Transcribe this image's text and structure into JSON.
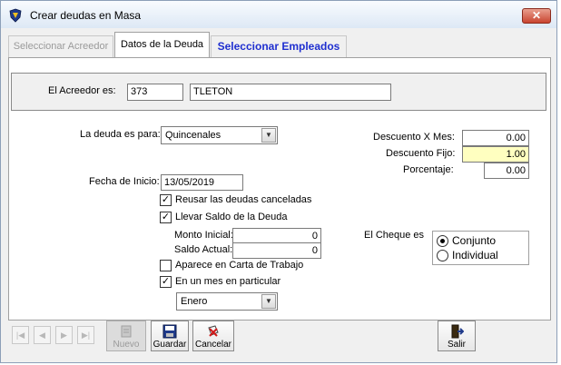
{
  "window": {
    "title": "Crear deudas en Masa",
    "close_label": "✕",
    "app_icon": "app-shield-icon"
  },
  "tabs": [
    {
      "label": "Seleccionar Acreedor",
      "state": "disabled"
    },
    {
      "label": "Datos de la Deuda",
      "state": "active"
    },
    {
      "label": "Seleccionar Empleados",
      "state": "highlighted"
    }
  ],
  "acreedor": {
    "label": "El Acreedor es:",
    "code": "373",
    "name": "TLETON"
  },
  "deuda": {
    "para_label": "La deuda es para:",
    "para_value": "Quincenales",
    "fecha_label": "Fecha de Inicio:",
    "fecha_value": "13/05/2019",
    "reusar_label": "Reusar las deudas canceladas",
    "reusar_checked": true,
    "saldo_label": "Llevar Saldo de la Deuda",
    "saldo_checked": true,
    "monto_inicial_label": "Monto Inicial:",
    "monto_inicial_value": "0",
    "saldo_actual_label": "Saldo Actual:",
    "saldo_actual_value": "0",
    "carta_label": "Aparece en Carta de Trabajo",
    "carta_checked": false,
    "mes_label": "En un mes en particular",
    "mes_checked": true,
    "mes_value": "Enero"
  },
  "descuentos": {
    "por_mes_label": "Descuento X Mes:",
    "por_mes_value": "0.00",
    "fijo_label": "Descuento Fijo:",
    "fijo_value": "1.00",
    "porcentaje_label": "Porcentaje:",
    "porcentaje_value": "0.00"
  },
  "cheque": {
    "label": "El Cheque es",
    "options": [
      {
        "label": "Conjunto",
        "selected": true
      },
      {
        "label": "Individual",
        "selected": false
      }
    ]
  },
  "navigation": {
    "first": "|◀",
    "prev": "◀",
    "next": "▶",
    "last": "▶|"
  },
  "toolbar": {
    "nuevo_label": "Nuevo",
    "guardar_label": "Guardar",
    "cancelar_label": "Cancelar",
    "salir_label": "Salir"
  },
  "colors": {
    "tab_highlight": "#1f2fd0",
    "fijo_background": "#ffffc0",
    "close_button": "#c94430"
  }
}
